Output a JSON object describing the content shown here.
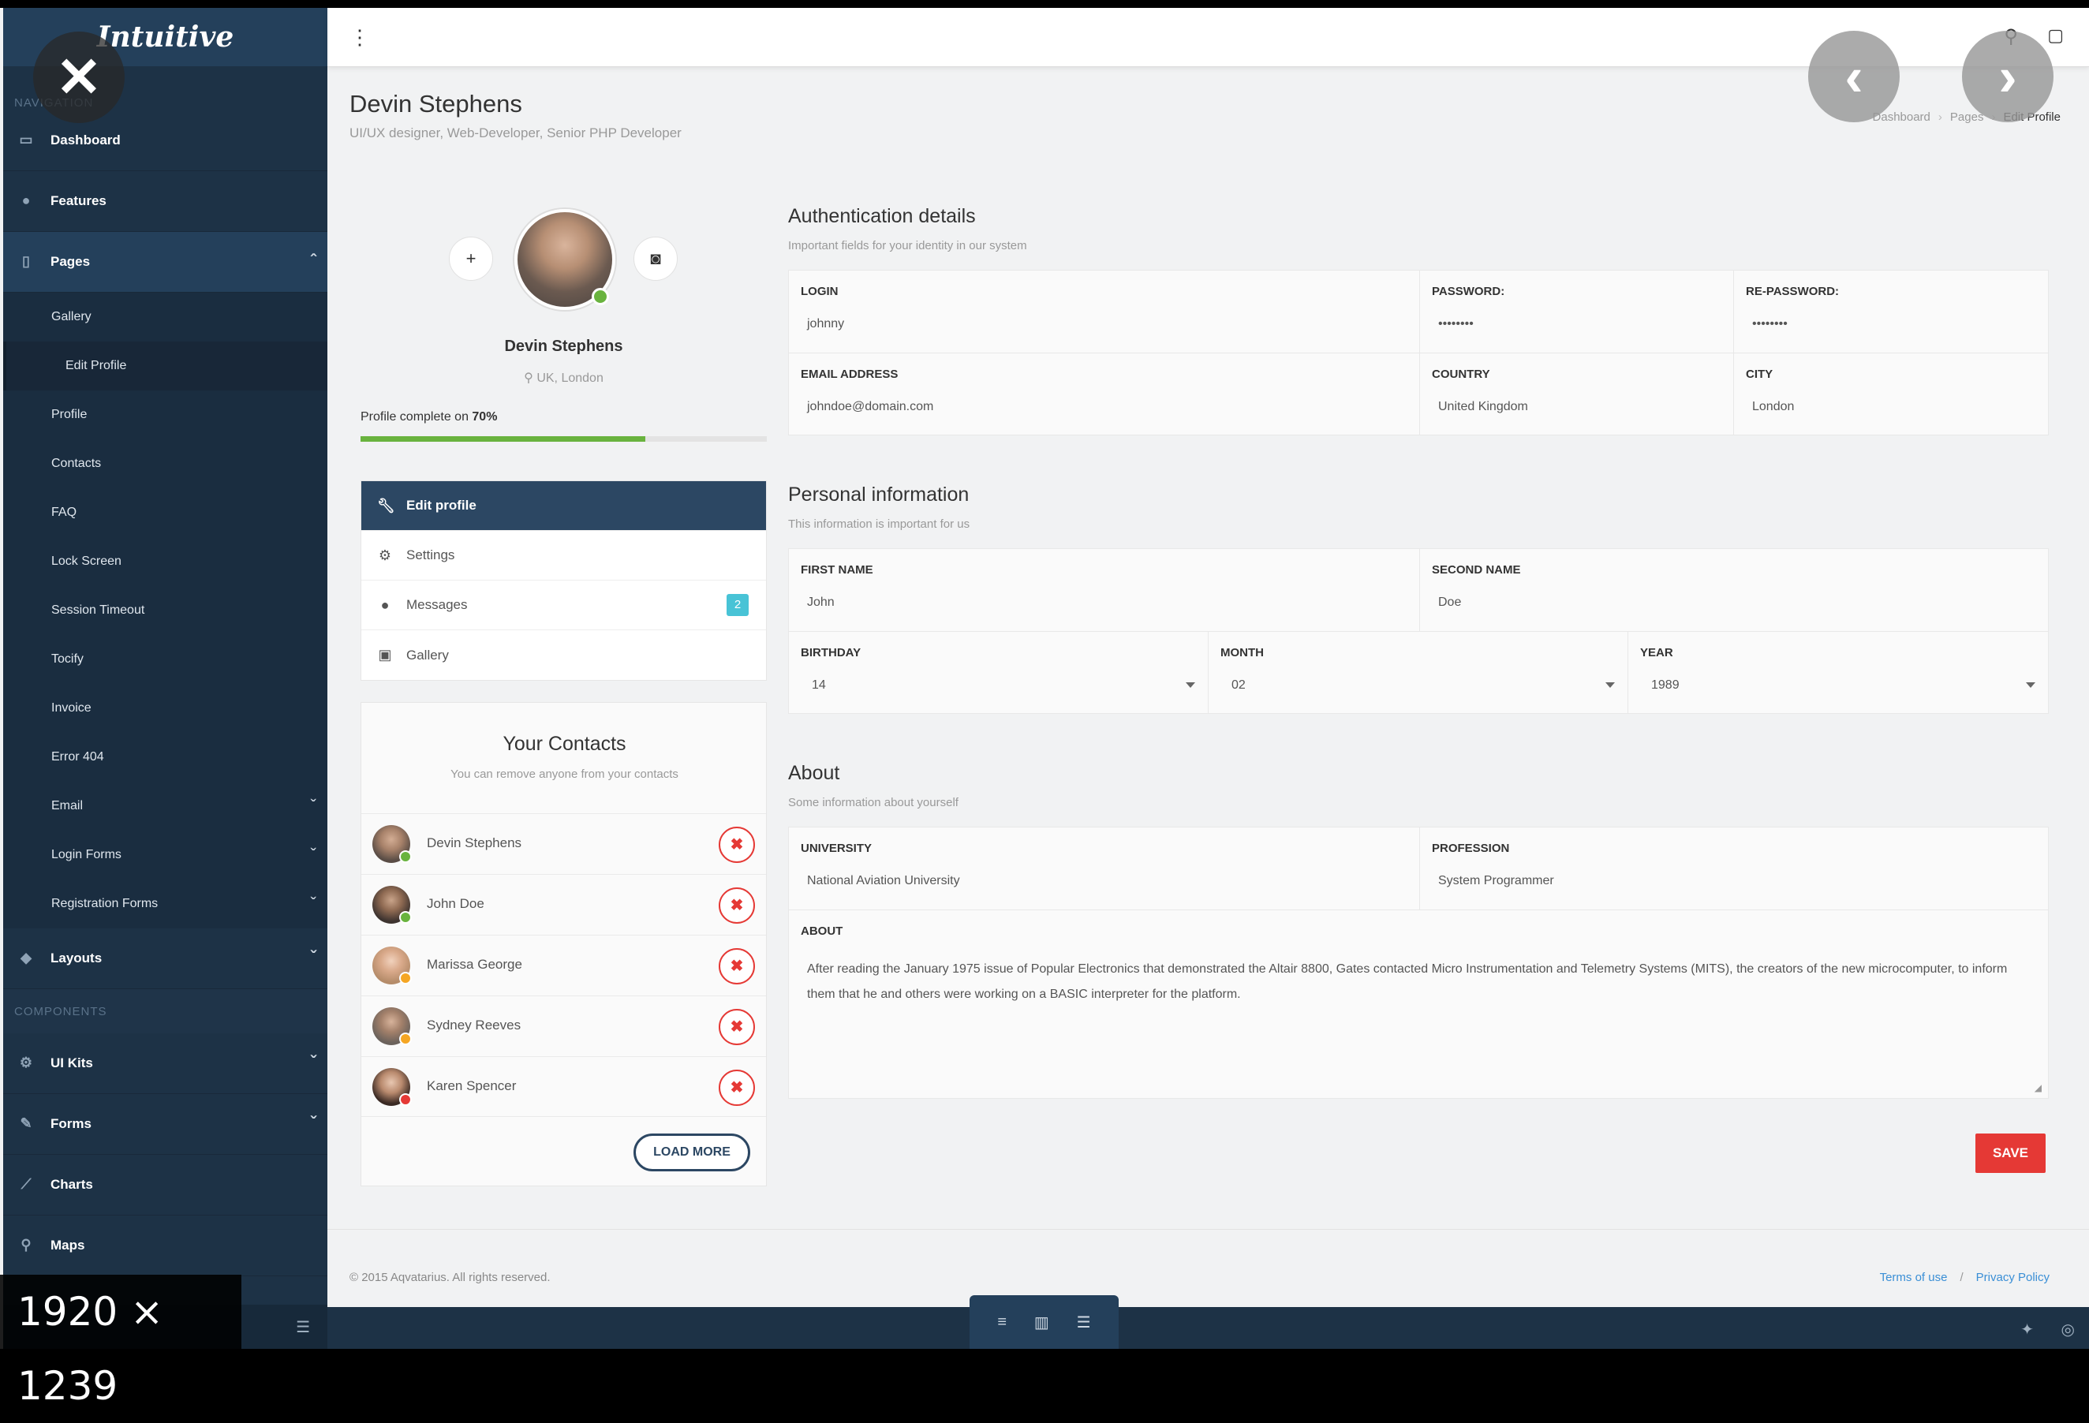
{
  "app": {
    "logo": "Intuitive"
  },
  "sidebar": {
    "navigation_heading": "NAVIGATION",
    "components_heading": "COMPONENTS",
    "items_top": [
      {
        "label": "Dashboard",
        "icon": "monitor-icon"
      },
      {
        "label": "Features",
        "icon": "globe-icon"
      },
      {
        "label": "Pages",
        "icon": "file-icon"
      }
    ],
    "pages_sub": [
      {
        "label": "Gallery"
      },
      {
        "label": "Edit Profile"
      },
      {
        "label": "Profile"
      },
      {
        "label": "Contacts"
      },
      {
        "label": "FAQ"
      },
      {
        "label": "Lock Screen"
      },
      {
        "label": "Session Timeout"
      },
      {
        "label": "Tocify"
      },
      {
        "label": "Invoice"
      },
      {
        "label": "Error 404"
      },
      {
        "label": "Email"
      },
      {
        "label": "Login Forms"
      },
      {
        "label": "Registration Forms"
      }
    ],
    "layouts": {
      "label": "Layouts",
      "icon": "cube-icon"
    },
    "components": [
      {
        "label": "UI Kits",
        "icon": "gears-icon"
      },
      {
        "label": "Forms",
        "icon": "pencil-icon"
      },
      {
        "label": "Charts",
        "icon": "chart-line-icon"
      },
      {
        "label": "Maps",
        "icon": "map-pin-icon"
      }
    ]
  },
  "header": {
    "title": "Devin Stephens",
    "subtitle": "UI/UX designer, Web-Developer, Senior PHP Developer",
    "breadcrumb": [
      "Dashboard",
      "Pages",
      "Edit Profile"
    ]
  },
  "profile": {
    "name": "Devin Stephens",
    "location": "UK, London",
    "complete_prefix": "Profile complete on ",
    "complete_value": "70%",
    "complete_fraction": 0.7
  },
  "menu": [
    {
      "label": "Edit profile",
      "icon": "wrench-icon"
    },
    {
      "label": "Settings",
      "icon": "gear-icon"
    },
    {
      "label": "Messages",
      "icon": "comment-icon",
      "badge": "2"
    },
    {
      "label": "Gallery",
      "icon": "image-icon"
    }
  ],
  "contacts": {
    "title": "Your Contacts",
    "subtitle": "You can remove anyone from your contacts",
    "list": [
      {
        "name": "Devin Stephens",
        "status_color": "#69b33e"
      },
      {
        "name": "John Doe",
        "status_color": "#69b33e"
      },
      {
        "name": "Marissa George",
        "status_color": "#f5a623"
      },
      {
        "name": "Sydney Reeves",
        "status_color": "#f5a623"
      },
      {
        "name": "Karen Spencer",
        "status_color": "#e53935"
      }
    ],
    "load_more": "LOAD MORE"
  },
  "auth": {
    "title": "Authentication details",
    "subtitle": "Important fields for your identity in our system",
    "login_label": "LOGIN",
    "login": "johnny",
    "password_label": "PASSWORD:",
    "password": "••••••••",
    "repassword_label": "RE-PASSWORD:",
    "repassword": "••••••••",
    "email_label": "EMAIL ADDRESS",
    "email": "johndoe@domain.com",
    "country_label": "COUNTRY",
    "country": "United Kingdom",
    "city_label": "CITY",
    "city": "London"
  },
  "personal": {
    "title": "Personal information",
    "subtitle": "This information is important for us",
    "first_label": "FIRST NAME",
    "first": "John",
    "second_label": "SECOND NAME",
    "second": "Doe",
    "birthday_label": "BIRTHDAY",
    "birthday": "14",
    "month_label": "MONTH",
    "month": "02",
    "year_label": "YEAR",
    "year": "1989"
  },
  "about": {
    "title": "About",
    "subtitle": "Some information about yourself",
    "university_label": "UNIVERSITY",
    "university": "National Aviation University",
    "profession_label": "PROFESSION",
    "profession": "System Programmer",
    "about_label": "ABOUT",
    "about_text": "After reading the January 1975 issue of Popular Electronics that demonstrated the Altair 8800, Gates contacted Micro Instrumentation and Telemetry Systems (MITS), the creators of the new microcomputer, to inform them that he and others were working on a BASIC interpreter for the platform."
  },
  "save_label": "SAVE",
  "footer": {
    "copyright": "© 2015 Aqvatarius. All rights reserved.",
    "terms": "Terms of use",
    "separator": "/",
    "privacy": "Privacy Policy"
  },
  "overlay": {
    "dimensions": "1920 × 1239"
  },
  "colors": {
    "sidebar": "#1d3246",
    "accent": "#2c4763",
    "success": "#69b33e",
    "danger": "#e53935",
    "badge": "#48c3d6"
  }
}
